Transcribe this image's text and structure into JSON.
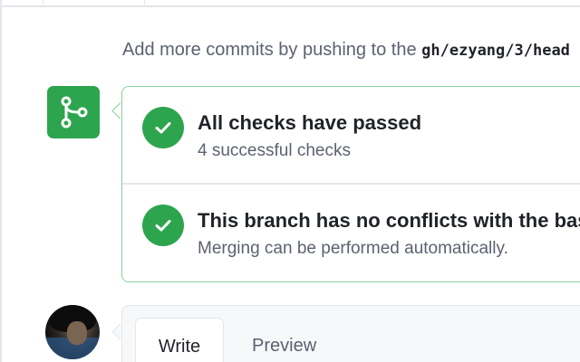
{
  "merge_status": {
    "push_hint_prefix": "Add more commits by pushing to the ",
    "branch_name": "gh/ezyang/3/head",
    "icon": "git-merge-icon",
    "checks": {
      "title": "All checks have passed",
      "subtitle": "4 successful checks",
      "icon": "check-icon"
    },
    "conflicts": {
      "title": "This branch has no conflicts with the base branch",
      "subtitle": "Merging can be performed automatically.",
      "icon": "check-icon"
    },
    "colors": {
      "success_green": "#2da44e",
      "border_green": "#86d494"
    }
  },
  "comment": {
    "tabs": [
      {
        "label": "Write",
        "selected": true
      },
      {
        "label": "Preview",
        "selected": false
      }
    ]
  }
}
